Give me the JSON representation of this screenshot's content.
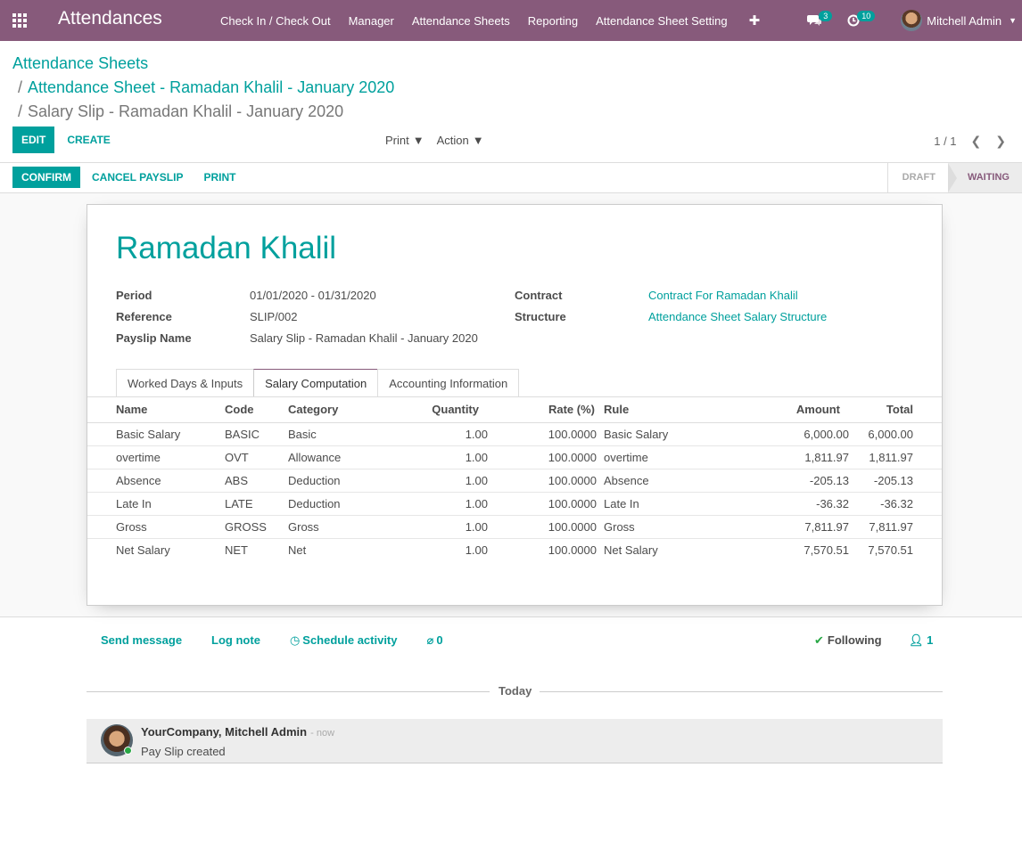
{
  "navbar": {
    "app_title": "Attendances",
    "menu": [
      "Check In / Check Out",
      "Manager",
      "Attendance Sheets",
      "Reporting",
      "Attendance Sheet Setting"
    ],
    "plus": "✚",
    "messages_count": "3",
    "activities_count": "10",
    "user_name": "Mitchell Admin",
    "bg_color": "#875a7b"
  },
  "breadcrumb": {
    "level1": "Attendance Sheets",
    "level2": "Attendance Sheet - Ramadan Khalil - January 2020",
    "current": "Salary Slip - Ramadan Khalil - January 2020"
  },
  "controls": {
    "edit": "EDIT",
    "create": "CREATE",
    "print": "Print",
    "action": "Action",
    "pager": "1 / 1"
  },
  "statusbar": {
    "confirm": "CONFIRM",
    "cancel": "CANCEL PAYSLIP",
    "print": "PRINT",
    "states": [
      "DRAFT",
      "WAITING"
    ],
    "active_state": "WAITING"
  },
  "form": {
    "employee": "Ramadan Khalil",
    "left": [
      {
        "label": "Period",
        "value": "01/01/2020 - 01/31/2020"
      },
      {
        "label": "Reference",
        "value": "SLIP/002"
      },
      {
        "label": "Payslip Name",
        "value": "Salary Slip - Ramadan Khalil - January 2020"
      }
    ],
    "right": [
      {
        "label": "Contract",
        "value": "Contract For Ramadan Khalil"
      },
      {
        "label": "Structure",
        "value": "Attendance Sheet Salary Structure"
      }
    ],
    "tabs": [
      "Worked Days & Inputs",
      "Salary Computation",
      "Accounting Information"
    ],
    "active_tab": "Salary Computation",
    "columns": [
      "Name",
      "Code",
      "Category",
      "Quantity",
      "Rate (%)",
      "Rule",
      "Amount",
      "Total"
    ],
    "rows": [
      [
        "Basic Salary",
        "BASIC",
        "Basic",
        "1.00",
        "100.0000",
        "Basic Salary",
        "6,000.00",
        "6,000.00"
      ],
      [
        "overtime",
        "OVT",
        "Allowance",
        "1.00",
        "100.0000",
        "overtime",
        "1,811.97",
        "1,811.97"
      ],
      [
        "Absence",
        "ABS",
        "Deduction",
        "1.00",
        "100.0000",
        "Absence",
        "-205.13",
        "-205.13"
      ],
      [
        "Late In",
        "LATE",
        "Deduction",
        "1.00",
        "100.0000",
        "Late In",
        "-36.32",
        "-36.32"
      ],
      [
        "Gross",
        "GROSS",
        "Gross",
        "1.00",
        "100.0000",
        "Gross",
        "7,811.97",
        "7,811.97"
      ],
      [
        "Net Salary",
        "NET",
        "Net",
        "1.00",
        "100.0000",
        "Net Salary",
        "7,570.51",
        "7,570.51"
      ]
    ]
  },
  "chatter": {
    "send_message": "Send message",
    "log_note": "Log note",
    "schedule": "Schedule activity",
    "attachments": "0",
    "following": "Following",
    "followers": "1",
    "date_separator": "Today",
    "message": {
      "author": "YourCompany, Mitchell Admin",
      "when": "- now",
      "body": "Pay Slip created"
    }
  }
}
